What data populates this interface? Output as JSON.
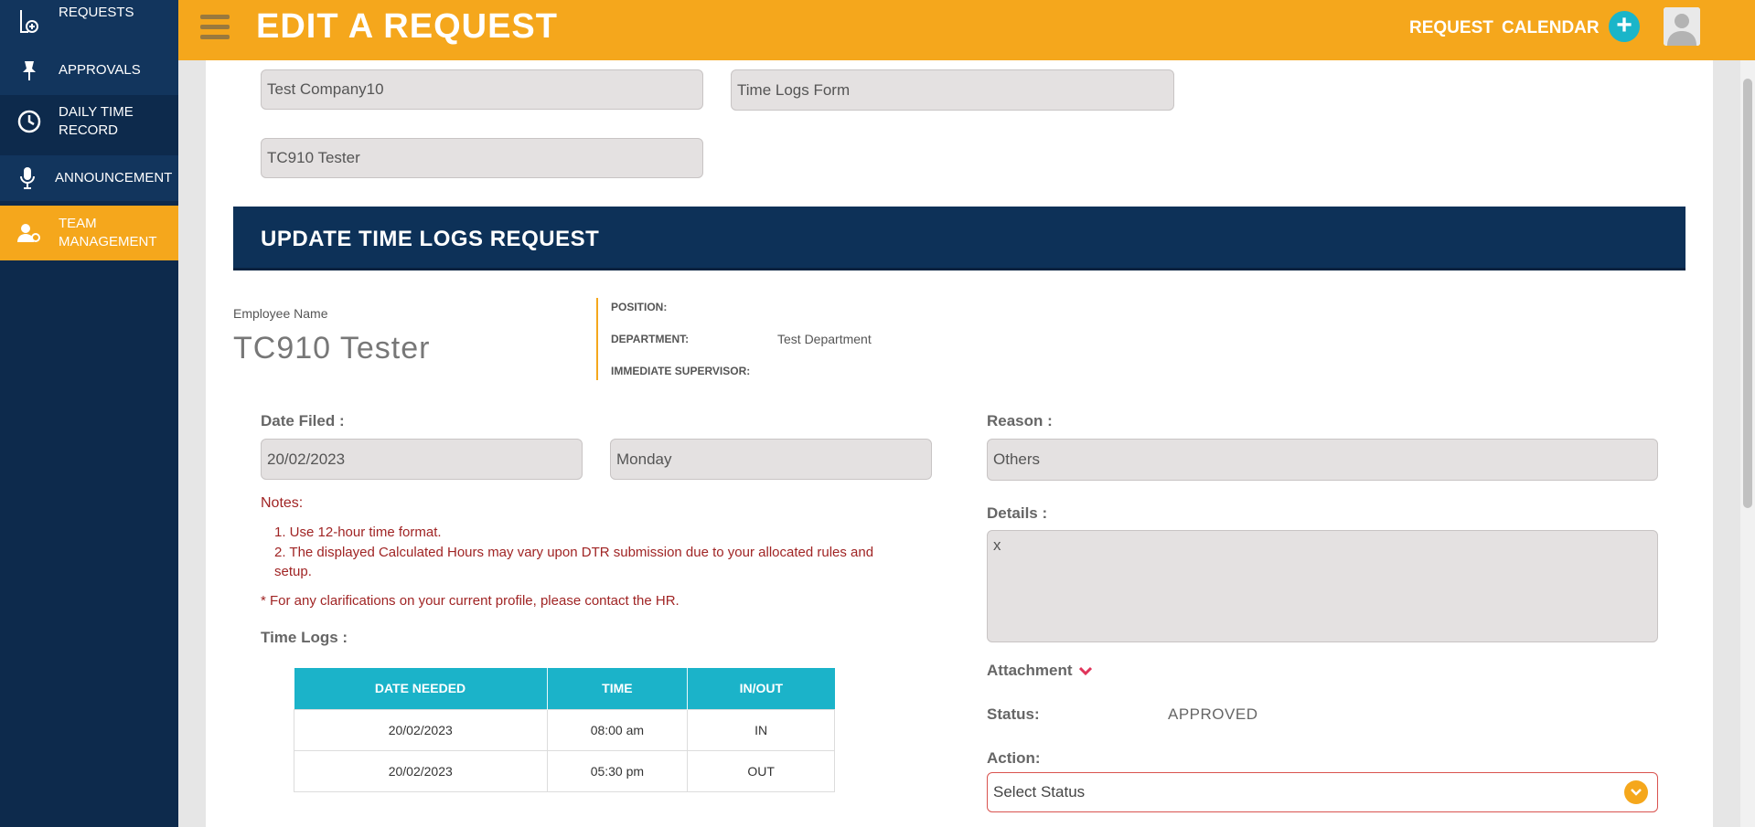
{
  "sidebar": {
    "items": [
      {
        "label": "REQUESTS",
        "icon": "file-add-icon"
      },
      {
        "label": "APPROVALS",
        "icon": "pin-icon"
      },
      {
        "label": "DAILY TIME RECORD",
        "icon": "clock-icon"
      },
      {
        "label": "ANNOUNCEMENT",
        "icon": "microphone-icon"
      },
      {
        "label": "TEAM MANAGEMENT",
        "icon": "user-gear-icon"
      }
    ]
  },
  "header": {
    "title": "EDIT A REQUEST",
    "request_link": "REQUEST",
    "calendar_link": "CALENDAR",
    "plus": "+"
  },
  "form": {
    "company": "Test Company10",
    "form_type": "Time Logs Form",
    "employee": "TC910 Tester"
  },
  "banner": {
    "title": "UPDATE TIME LOGS REQUEST"
  },
  "employee": {
    "name_label": "Employee Name",
    "name": "TC910 Tester",
    "position_label": "POSITION:",
    "position": "",
    "department_label": "DEPARTMENT:",
    "department": "Test Department",
    "supervisor_label": "IMMEDIATE SUPERVISOR:",
    "supervisor": ""
  },
  "date_filed": {
    "label": "Date Filed :",
    "date": "20/02/2023",
    "day": "Monday"
  },
  "notes": {
    "title": "Notes:",
    "item1": "1. Use 12-hour time format.",
    "item2a": "2. The displayed Calculated Hours may vary upon DTR submission due to your allocated rules and",
    "item2b": "setup.",
    "footer": "* For any clarifications on your current profile, please contact the HR."
  },
  "time_logs": {
    "label": "Time Logs :",
    "headers": [
      "DATE NEEDED",
      "TIME",
      "IN/OUT"
    ],
    "rows": [
      [
        "20/02/2023",
        "08:00 am",
        "IN"
      ],
      [
        "20/02/2023",
        "05:30 pm",
        "OUT"
      ]
    ]
  },
  "reason": {
    "label": "Reason :",
    "value": "Others"
  },
  "details": {
    "label": "Details :",
    "value": "x"
  },
  "attachment": {
    "label": "Attachment"
  },
  "status": {
    "label": "Status:",
    "value": "APPROVED"
  },
  "action": {
    "label": "Action:",
    "placeholder": "Select Status"
  },
  "colors": {
    "accent": "#f5a71c",
    "navy": "#0d2a4c",
    "teal": "#1bb3c9",
    "note_red": "#a02424"
  }
}
